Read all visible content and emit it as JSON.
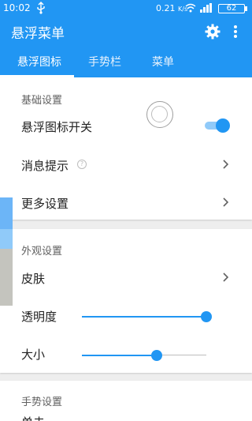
{
  "status_bar": {
    "time": "10:02",
    "usb_icon": "usb-icon",
    "speed": "0.21 ",
    "speed_unit": "K/s",
    "battery_level": "62"
  },
  "app_bar": {
    "title": "悬浮菜单",
    "settings_icon": "gear-icon",
    "more_icon": "more-vert-icon"
  },
  "tabs": [
    {
      "label": "悬浮图标",
      "selected": true
    },
    {
      "label": "手势栏",
      "selected": false
    },
    {
      "label": "菜单",
      "selected": false
    }
  ],
  "sections": {
    "basic": {
      "title": "基础设置",
      "float_icon_switch": {
        "label": "悬浮图标开关",
        "on": true
      },
      "notifications": {
        "label": "消息提示"
      },
      "more_settings": {
        "label": "更多设置"
      }
    },
    "appearance": {
      "title": "外观设置",
      "skin": {
        "label": "皮肤"
      },
      "opacity": {
        "label": "透明度",
        "value": 1.0
      },
      "size": {
        "label": "大小",
        "value": 0.6
      }
    },
    "gesture": {
      "title": "手势设置",
      "single_tap": {
        "label": "单击"
      }
    }
  },
  "colors": {
    "primary": "#2196f3",
    "primary_light": "#90caf9",
    "background": "#eeeeee"
  }
}
